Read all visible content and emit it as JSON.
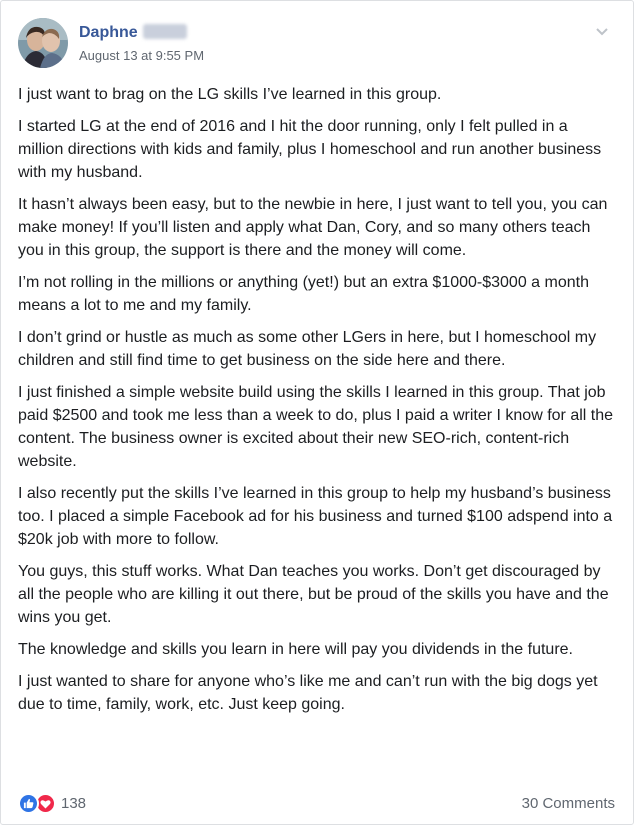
{
  "post": {
    "author": "Daphne",
    "timestamp": "August 13 at 9:55 PM",
    "paragraphs": [
      "I just want to brag on the LG skills I’ve learned in this group.",
      "I started LG at the end of 2016 and I hit the door running, only I felt pulled in a million directions with kids and family, plus I homeschool and run another business with my husband.",
      "It hasn’t always been easy, but to the newbie in here, I just want to tell you, you can make money! If you’ll listen and apply what Dan, Cory, and so many others teach you in this group, the support is there and the money will come.",
      "I’m not rolling in the millions or anything (yet!) but an extra $1000-$3000 a month means a lot to me and my family.",
      "I don’t grind or hustle as much as some other LGers in here, but I homeschool my children and still find time to get business on the side here and there.",
      "I just finished a simple website build using the skills I learned in this group. That job paid $2500 and took me less than a week to do, plus I paid a writer I know for all the content. The business owner is excited about their new SEO-rich, content-rich website.",
      "I also recently put the skills I’ve learned in this group to help my husband’s business too. I placed a simple Facebook ad for his business and turned $100 adspend into a $20k job with more to follow.",
      "You guys, this stuff works. What Dan teaches you works. Don’t get discouraged by all the people who are killing it out there, but be proud of the skills you have and the wins you get.",
      "The knowledge and skills you learn in here will pay you dividends in the future.",
      "I just wanted to share for anyone who’s like me and can’t run with the big dogs yet due to time, family, work, etc. Just keep going."
    ]
  },
  "footer": {
    "reaction_count": "138",
    "comments_label": "30 Comments",
    "reaction_icons": [
      "like-icon",
      "love-icon"
    ]
  },
  "colors": {
    "author_link": "#385898",
    "meta_text": "#606770",
    "like_blue": "#2f74e5",
    "love_red": "#f0284a"
  }
}
